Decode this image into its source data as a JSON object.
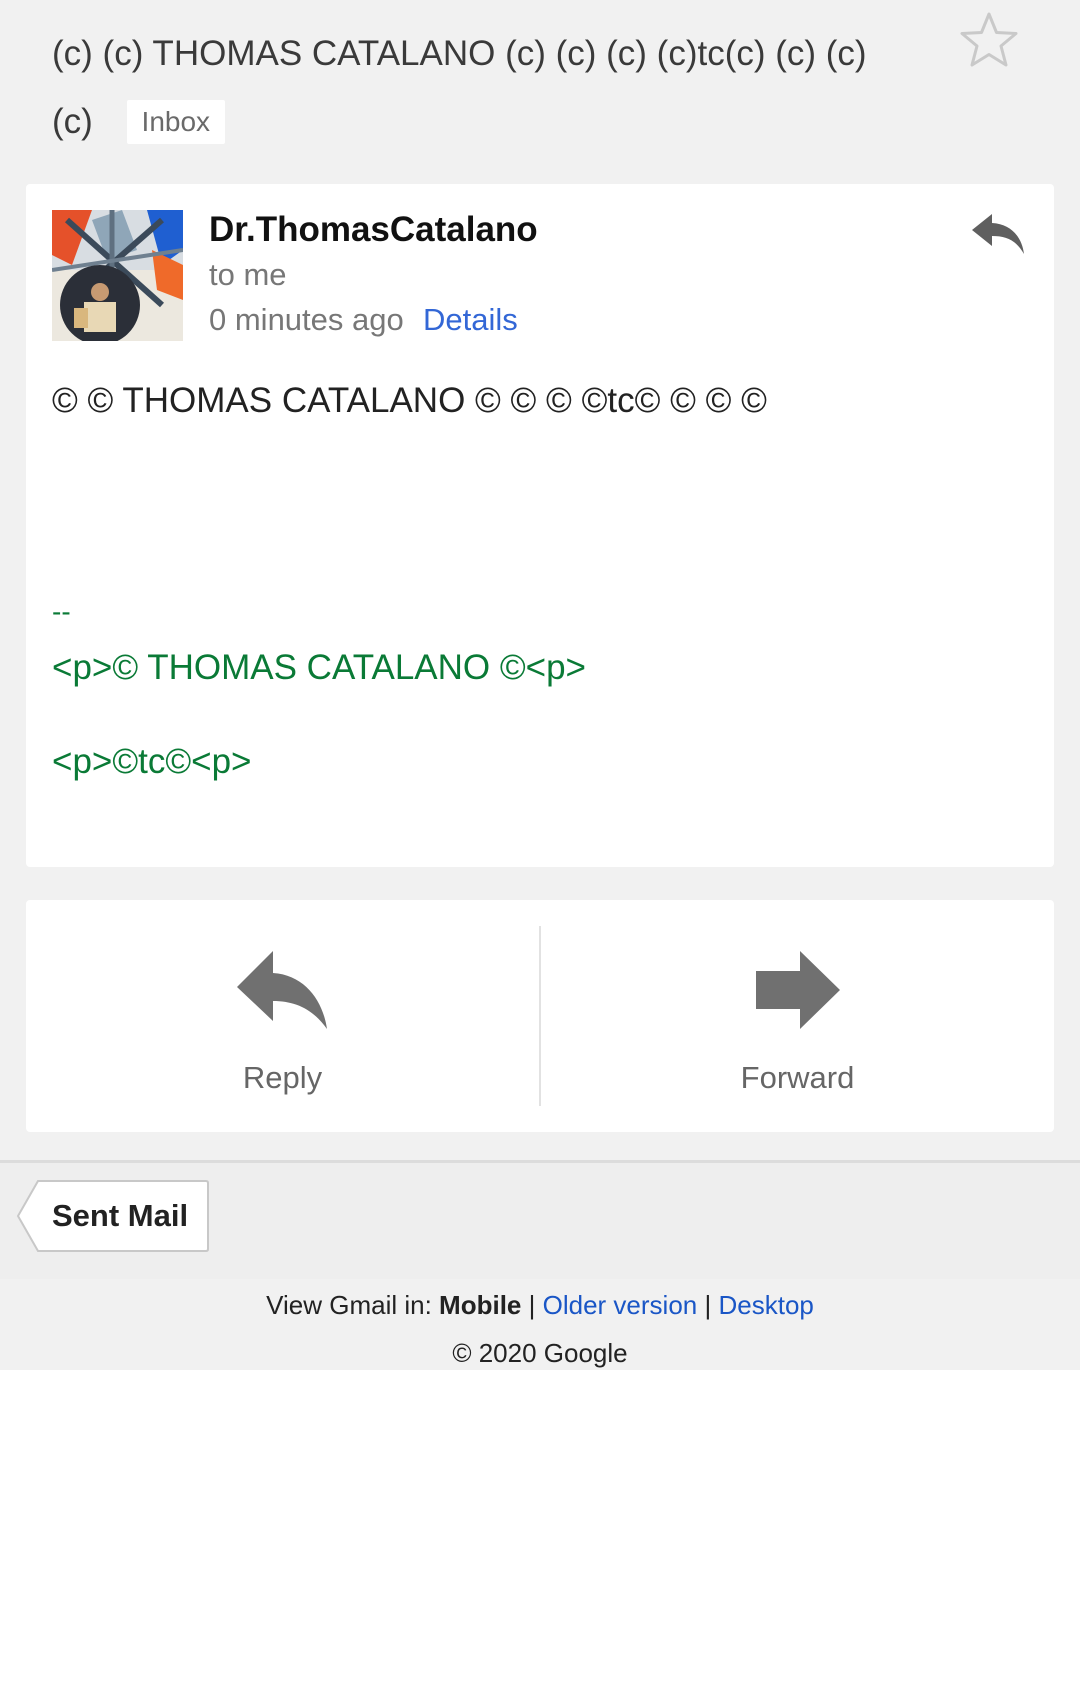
{
  "header": {
    "subject": "(c) (c) THOMAS CATALANO (c) (c) (c) (c)tc(c) (c) (c) (c)",
    "label_badge": "Inbox",
    "star_icon": "star-outline-icon"
  },
  "message": {
    "sender": "Dr.ThomasCatalano",
    "recipient": "to me",
    "time": "0 minutes ago",
    "details_link": "Details",
    "reply_icon": "reply-icon",
    "body_line": "© © THOMAS CATALANO © © © ©tc© © © ©",
    "signature": {
      "separator": "--",
      "line1": "<p>© THOMAS CATALANO ©<p>",
      "line2": "<p>©tc©<p>"
    }
  },
  "actions": {
    "reply_label": "Reply",
    "forward_label": "Forward"
  },
  "nav": {
    "back_label": "Sent Mail"
  },
  "footer": {
    "view_prefix": "View Gmail in:",
    "mobile": "Mobile",
    "separator": "|",
    "older_version": "Older version",
    "desktop": "Desktop",
    "copyright": "© 2020 Google"
  },
  "colors": {
    "link": "#3367d6",
    "signature_green": "#0a7a36",
    "icon_gray": "#666666",
    "page_bg": "#f1f1f1"
  }
}
